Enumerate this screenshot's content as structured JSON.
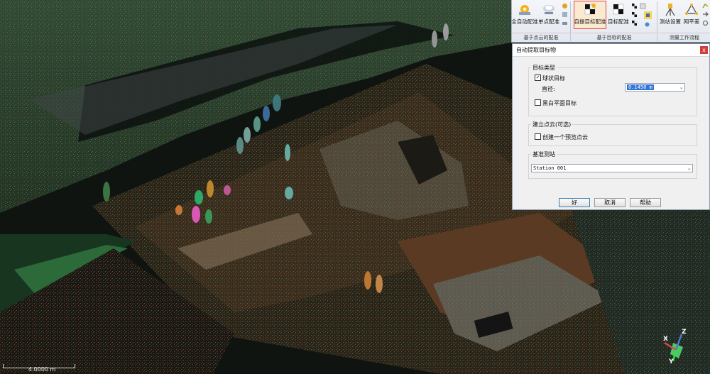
{
  "ribbon": {
    "buttons": [
      {
        "label": "全自动配准",
        "icon": "auto-register-icon"
      },
      {
        "label": "单点配准",
        "icon": "single-point-register-icon"
      },
      {
        "label": "自提目标配准",
        "icon": "target-extract-register-icon"
      },
      {
        "label": "目标配准",
        "icon": "target-register-icon"
      },
      {
        "label": "测站设置",
        "icon": "station-setup-icon"
      },
      {
        "label": "网平差",
        "icon": "network-adjustment-icon"
      }
    ],
    "groups": [
      "基于点云的配准",
      "基于目标的配准",
      "测量工作流程"
    ]
  },
  "dialog": {
    "title": "自动提取目标物",
    "close_glyph": "x",
    "target_type": {
      "legend": "目标类型",
      "sphere_label": "球状目标",
      "sphere_checked": true,
      "diameter_label": "直径:",
      "diameter_value": "0.1450 m",
      "checker_label": "黑白平面目标",
      "checker_checked": false
    },
    "build_cloud": {
      "legend": "建立点云(可选)",
      "preview_label": "创建一个预览点云",
      "preview_checked": false
    },
    "base_station": {
      "legend": "基准测站",
      "value": "Station 001"
    },
    "buttons": {
      "ok": "好",
      "cancel": "取消",
      "help": "帮助"
    }
  },
  "viewport": {
    "scale_label": "4.0000 m",
    "axes": {
      "x": "X",
      "y": "Y",
      "z": "Z"
    }
  }
}
